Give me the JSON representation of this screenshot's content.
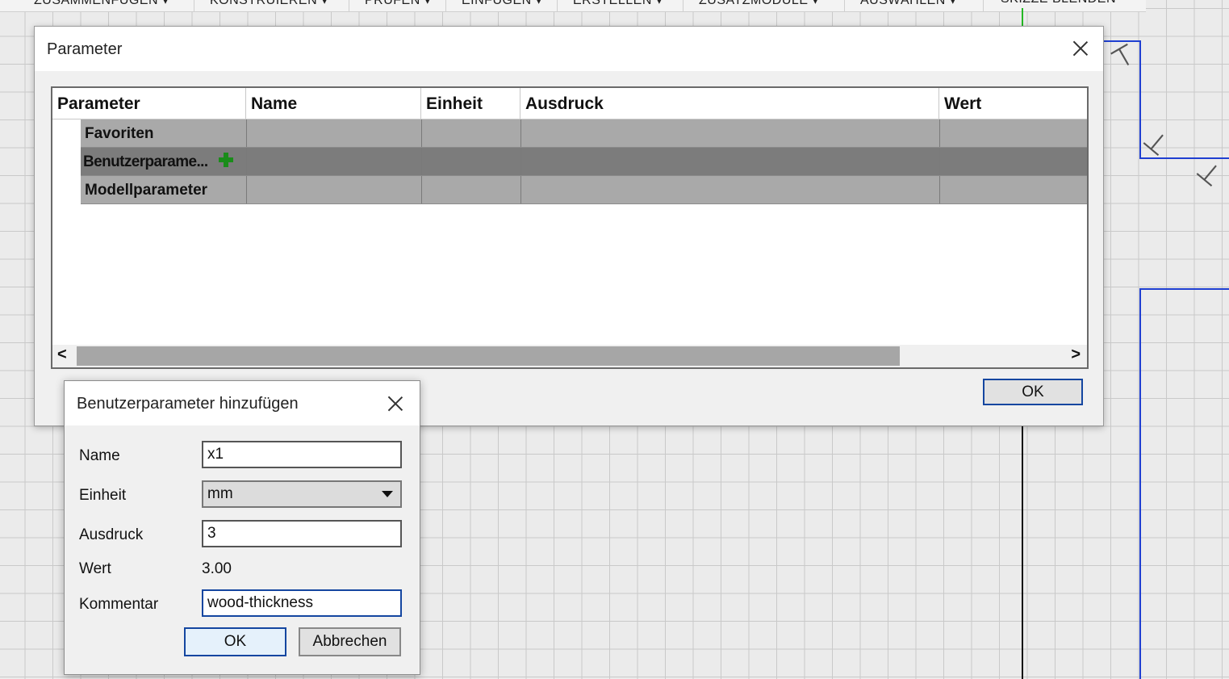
{
  "toolbar": {
    "items": [
      "ZUSAMMENFÜGEN ▾",
      "KONSTRUIEREN ▾",
      "PRÜFEN ▾",
      "EINFÜGEN ▾",
      "ERSTELLEN ▾",
      "ZUSATZMODULE ▾",
      "AUSWÄHLEN ▾",
      "SKIZZE BLENDEN"
    ]
  },
  "param_dialog": {
    "title": "Parameter",
    "columns": [
      "Parameter",
      "Name",
      "Einheit",
      "Ausdruck",
      "Wert"
    ],
    "groups": [
      {
        "label": "Favoriten",
        "selected": false
      },
      {
        "label": "Benutzerparame...",
        "selected": true
      },
      {
        "label": "Modellparameter",
        "selected": false
      }
    ],
    "scroll_left": "<",
    "scroll_right": ">",
    "ok_label": "OK"
  },
  "add_dialog": {
    "title": "Benutzerparameter hinzufügen",
    "name_label": "Name",
    "name_value": "x1",
    "unit_label": "Einheit",
    "unit_value": "mm",
    "expression_label": "Ausdruck",
    "expression_value": "3",
    "value_label": "Wert",
    "value_value": "3.00",
    "comment_label": "Kommentar",
    "comment_value": "wood-thickness",
    "ok_label": "OK",
    "cancel_label": "Abbrechen"
  },
  "colors": {
    "accent": "#1446a0",
    "selected_row": "#7c7c7c",
    "group_row": "#a9a9a9",
    "add_icon": "#1a8c1a",
    "sketch_line": "#1f3fd1"
  }
}
